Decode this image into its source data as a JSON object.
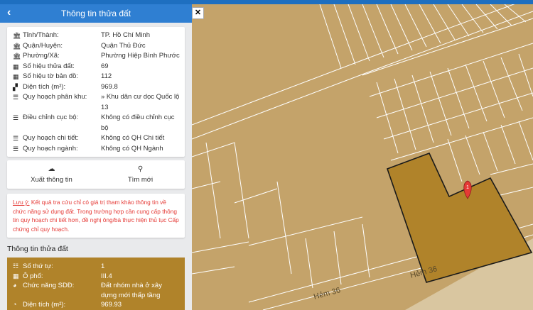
{
  "header": {
    "title": "Thông tin thửa đất"
  },
  "info": [
    {
      "icon": "bank-icon",
      "glyph": "🏛",
      "label": "Tỉnh/Thành:",
      "value": "TP. Hồ Chí Minh"
    },
    {
      "icon": "bank-icon",
      "glyph": "🏛",
      "label": "Quận/Huyện:",
      "value": "Quận Thủ Đức"
    },
    {
      "icon": "bank-icon",
      "glyph": "🏛",
      "label": "Phường/Xã:",
      "value": "Phường Hiệp Bình Phước"
    },
    {
      "icon": "map-icon",
      "glyph": "▦",
      "label": "Số hiệu thửa đất:",
      "value": "69"
    },
    {
      "icon": "map-icon",
      "glyph": "▦",
      "label": "Số hiệu tờ bản đồ:",
      "value": "112"
    },
    {
      "icon": "area-icon",
      "glyph": "▞",
      "label": "Diện tích (m²):",
      "value": "969.8"
    },
    {
      "icon": "list-icon",
      "glyph": "☰",
      "label": "Quy hoạch phân khu:",
      "value": "» Khu dân cư dọc Quốc lộ 13"
    },
    {
      "icon": "list-icon",
      "glyph": "☰",
      "label": "Điều chỉnh cục bộ:",
      "value": "Không có điều chỉnh cục bộ"
    },
    {
      "icon": "list-icon",
      "glyph": "☰",
      "label": "Quy hoạch chi tiết:",
      "value": "Không có QH Chi tiết"
    },
    {
      "icon": "list-icon",
      "glyph": "☰",
      "label": "Quy hoạch ngành:",
      "value": "Không có QH Ngành"
    }
  ],
  "actions": {
    "export_label": "Xuất thông tin",
    "search_label": "Tìm mới"
  },
  "note": {
    "prefix": "Lưu ý:",
    "text": " Kết quả tra cứu chỉ có giá trị tham khảo thông tin về chức năng sử dụng đất. Trong trường hợp cần cung cấp thông tin quy hoạch chi tiết hơn, đề nghị ông/bà thực hiện thủ tục Cấp chứng chỉ quy hoạch."
  },
  "section_title": "Thông tin thửa đất",
  "parcel": [
    {
      "icon": "ordered-list-icon",
      "glyph": "☷",
      "label": "Số thứ tự:",
      "value": "1"
    },
    {
      "icon": "grid-icon",
      "glyph": "▦",
      "label": "Ô phố:",
      "value": "III.4"
    },
    {
      "icon": "globe-icon",
      "glyph": "◕",
      "label": "Chức năng SDĐ:",
      "value": "Đất nhóm nhà ở xây dựng mới thấp tầng"
    },
    {
      "icon": "pie-icon",
      "glyph": "◔",
      "label": "Diện tích (m²):",
      "value": "969.93"
    }
  ],
  "map": {
    "road_label": "Hẻm 36",
    "marker_label": "1",
    "colors": {
      "land": "#c4a36a",
      "lines": "#ffffff",
      "parcel_outline": "#1a1a1a",
      "marker": "#e53935"
    }
  }
}
